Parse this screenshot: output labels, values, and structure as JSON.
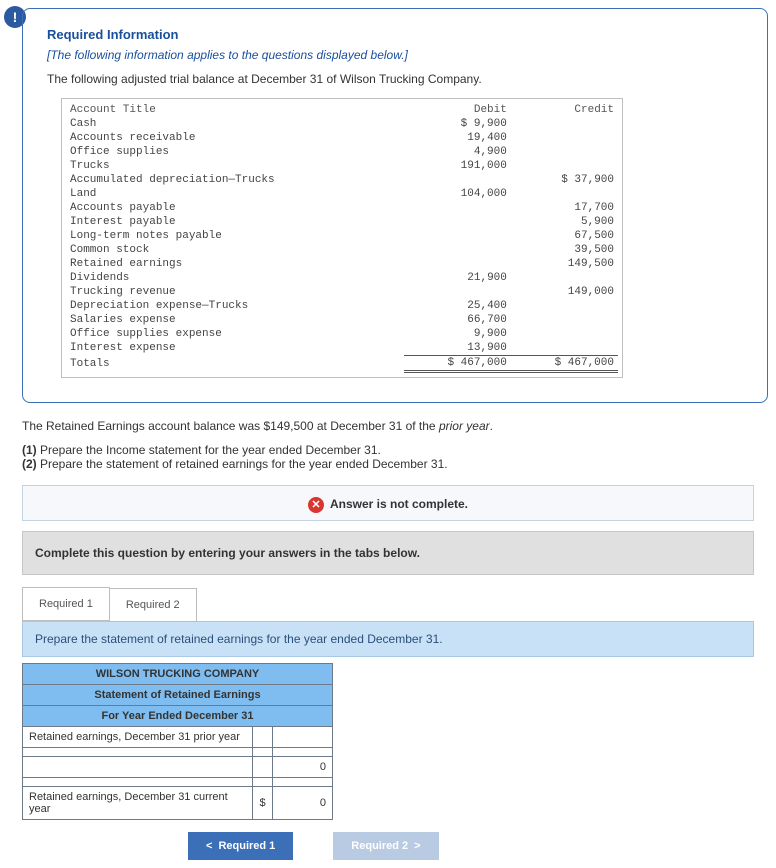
{
  "alertGlyph": "!",
  "reqTitle": "Required Information",
  "reqSub": "[The following information applies to the questions displayed below.]",
  "intro": "The following adjusted trial balance at December 31 of Wilson Trucking Company.",
  "tb": {
    "h1": "Account Title",
    "h2": "Debit",
    "h3": "Credit",
    "rows": [
      {
        "a": "Cash",
        "d": "$ 9,900",
        "c": ""
      },
      {
        "a": "Accounts receivable",
        "d": "19,400",
        "c": ""
      },
      {
        "a": "Office supplies",
        "d": "4,900",
        "c": ""
      },
      {
        "a": "Trucks",
        "d": "191,000",
        "c": ""
      },
      {
        "a": "Accumulated depreciation—Trucks",
        "d": "",
        "c": "$ 37,900"
      },
      {
        "a": "Land",
        "d": "104,000",
        "c": ""
      },
      {
        "a": "Accounts payable",
        "d": "",
        "c": "17,700"
      },
      {
        "a": "Interest payable",
        "d": "",
        "c": "5,900"
      },
      {
        "a": "Long-term notes payable",
        "d": "",
        "c": "67,500"
      },
      {
        "a": "Common stock",
        "d": "",
        "c": "39,500"
      },
      {
        "a": "Retained earnings",
        "d": "",
        "c": "149,500"
      },
      {
        "a": "Dividends",
        "d": "21,900",
        "c": ""
      },
      {
        "a": "Trucking revenue",
        "d": "",
        "c": "149,000"
      },
      {
        "a": "Depreciation expense—Trucks",
        "d": "25,400",
        "c": ""
      },
      {
        "a": "Salaries expense",
        "d": "66,700",
        "c": ""
      },
      {
        "a": "Office supplies expense",
        "d": "9,900",
        "c": ""
      },
      {
        "a": "Interest expense",
        "d": "13,900",
        "c": ""
      }
    ],
    "totLabel": "Totals",
    "totD": "$ 467,000",
    "totC": "$ 467,000"
  },
  "postText": "The Retained Earnings account balance was $149,500 at December 31 of the prior year.",
  "q1b": "(1)",
  "q1": " Prepare the Income statement for the year ended December 31.",
  "q2b": "(2)",
  "q2": " Prepare the statement of retained earnings for the year ended December 31.",
  "banner": "Answer is not complete.",
  "completeBar": "Complete this question by entering your answers in the tabs below.",
  "tab1": "Required 1",
  "tab2": "Required 2",
  "instr": "Prepare the statement of retained earnings for the year ended December 31.",
  "stmt": {
    "h1": "WILSON TRUCKING COMPANY",
    "h2": "Statement of Retained Earnings",
    "h3": "For Year Ended December 31",
    "r1": "Retained earnings, December 31 prior year",
    "r2": "",
    "r3": "",
    "r4": "",
    "r5": "Retained earnings, December 31 current year",
    "v3": "0",
    "sym5": "$",
    "v5": "0"
  },
  "nav": {
    "prev": "Required 1",
    "next": "Required 2"
  }
}
